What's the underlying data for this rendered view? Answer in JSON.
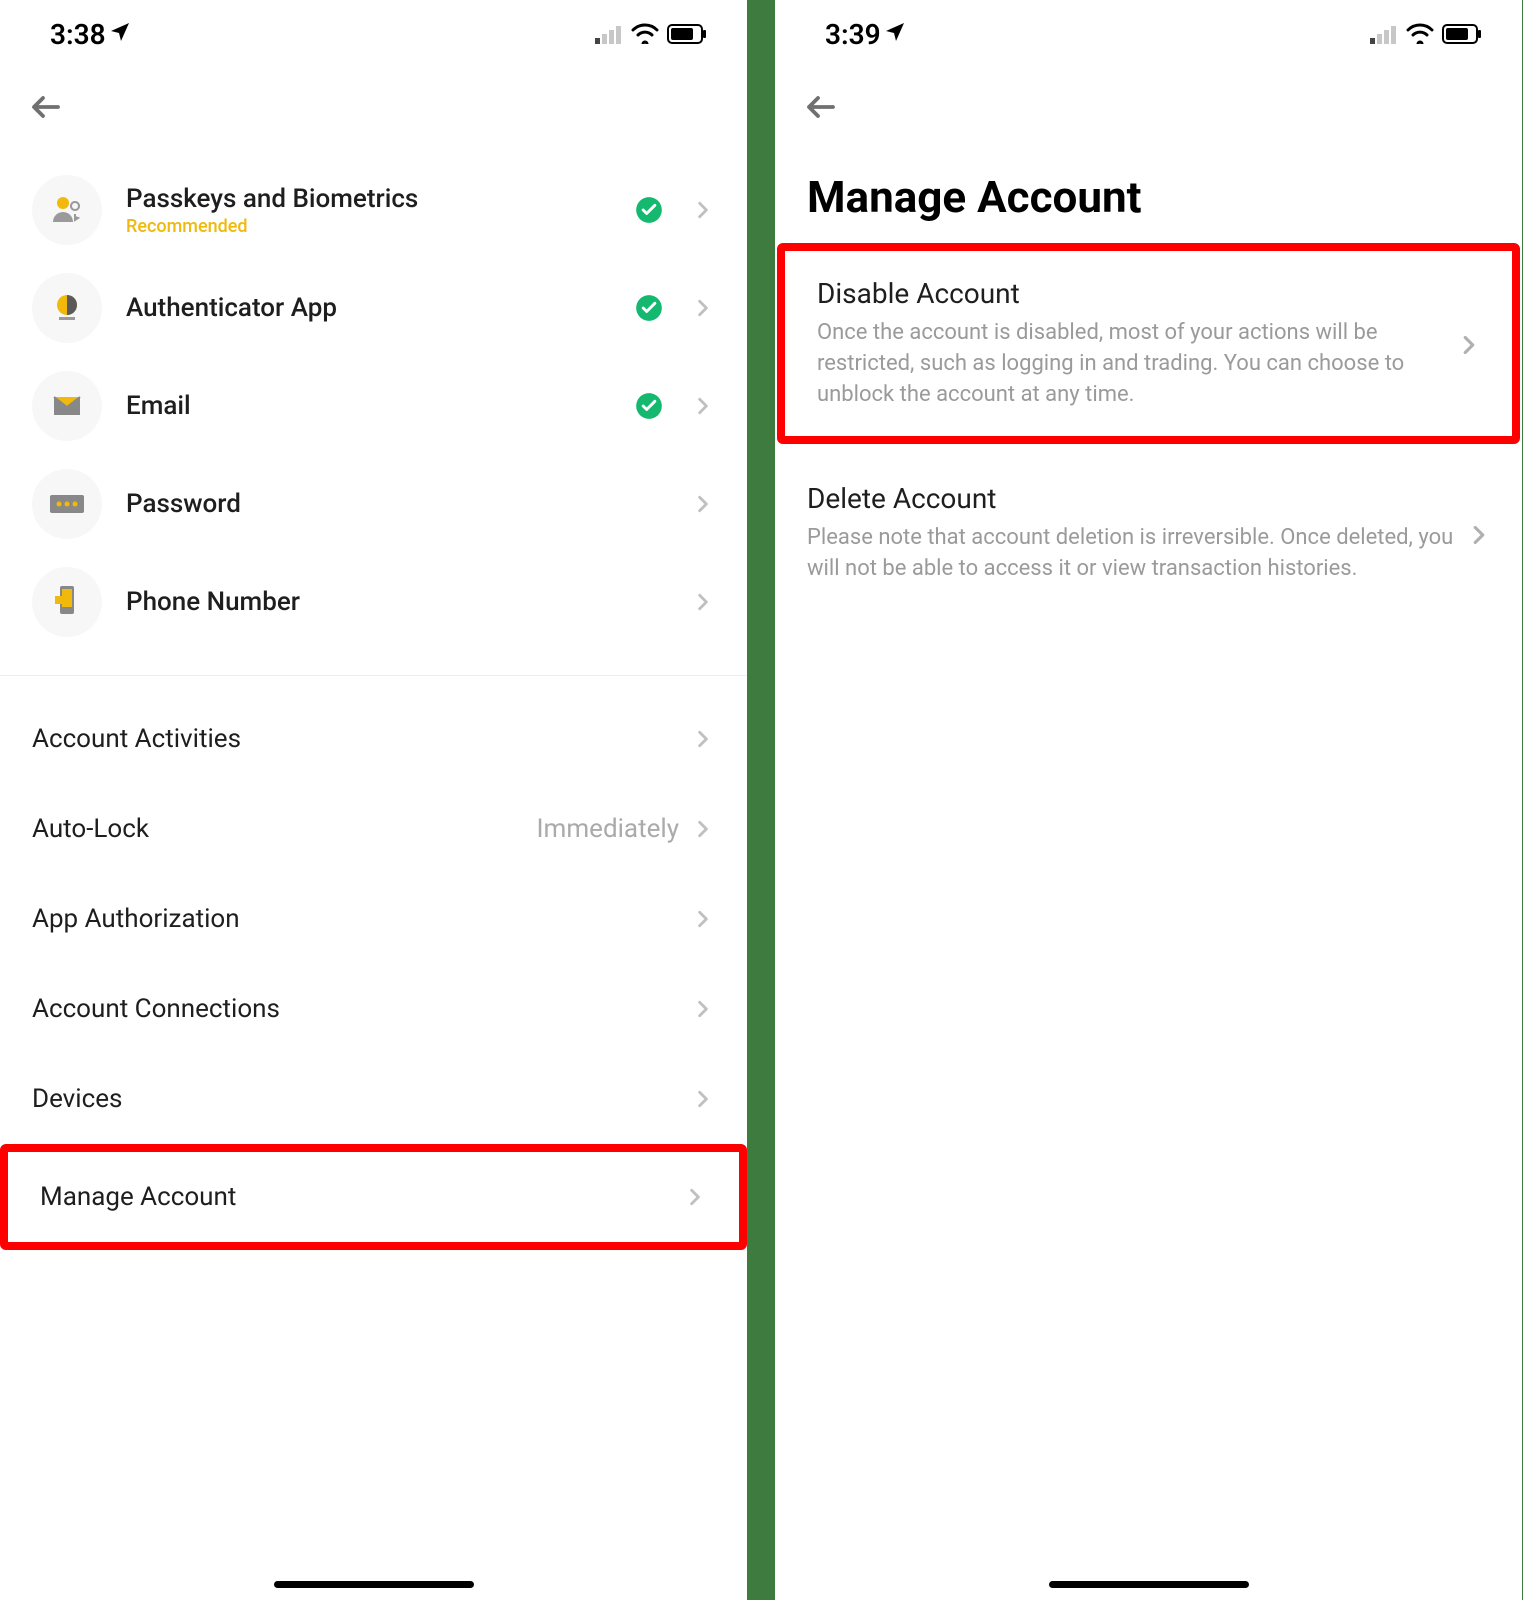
{
  "left": {
    "status": {
      "time": "3:38"
    },
    "security": [
      {
        "title": "Passkeys and Biometrics",
        "sub": "Recommended",
        "checked": true
      },
      {
        "title": "Authenticator App",
        "checked": true
      },
      {
        "title": "Email",
        "checked": true
      },
      {
        "title": "Password",
        "checked": false
      },
      {
        "title": "Phone Number",
        "checked": false
      }
    ],
    "plain": [
      {
        "title": "Account Activities"
      },
      {
        "title": "Auto-Lock",
        "value": "Immediately"
      },
      {
        "title": "App Authorization"
      },
      {
        "title": "Account Connections"
      },
      {
        "title": "Devices"
      },
      {
        "title": "Manage Account",
        "highlight": true
      }
    ]
  },
  "right": {
    "status": {
      "time": "3:39"
    },
    "heading": "Manage Account",
    "items": [
      {
        "title": "Disable Account",
        "desc": "Once the account is disabled, most of your actions will be restricted, such as logging in and trading. You can choose to unblock the account at any time.",
        "highlight": true
      },
      {
        "title": "Delete Account",
        "desc": "Please note that account deletion is irreversible. Once deleted, you will not be able to access it or view transaction histories."
      }
    ]
  }
}
